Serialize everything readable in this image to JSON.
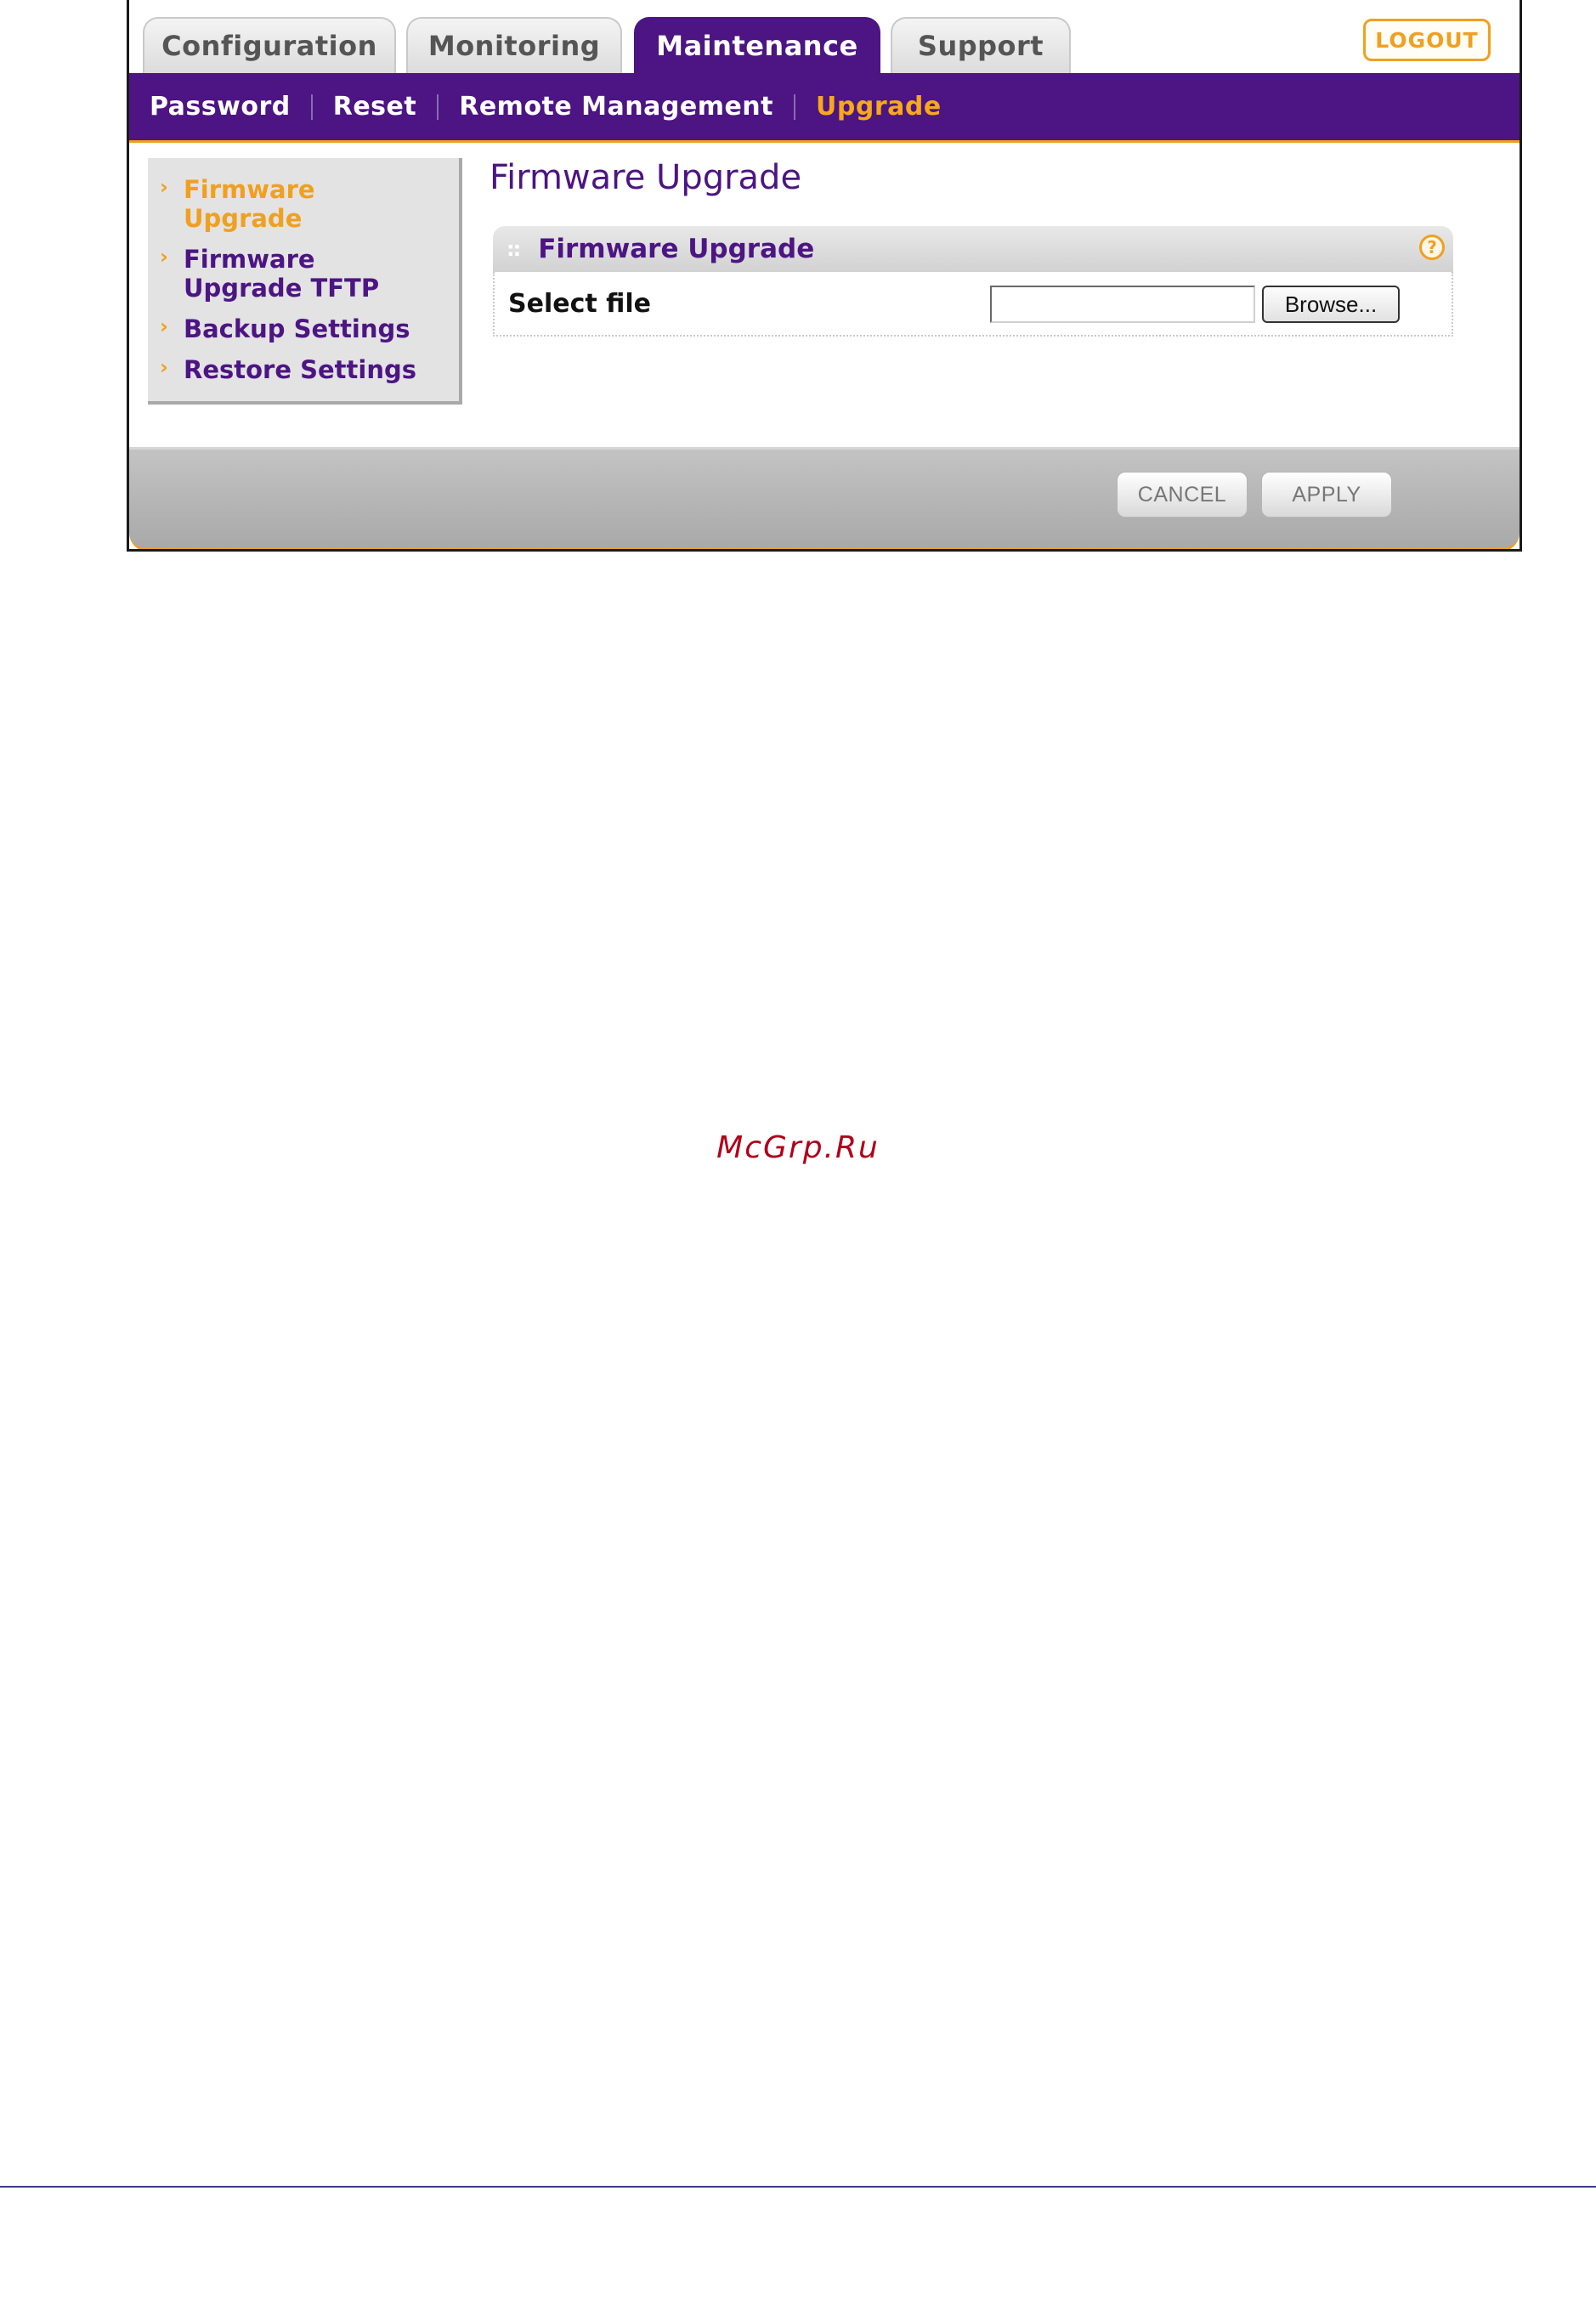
{
  "tabs": [
    {
      "label": "Configuration",
      "active": false
    },
    {
      "label": "Monitoring",
      "active": false
    },
    {
      "label": "Maintenance",
      "active": true
    },
    {
      "label": "Support",
      "active": false
    }
  ],
  "logout_label": "LOGOUT",
  "subnav": {
    "items": [
      "Password",
      "Reset",
      "Remote Management",
      "Upgrade"
    ],
    "current": "Upgrade"
  },
  "sidebar": {
    "items": [
      {
        "label": "Firmware Upgrade",
        "current": true
      },
      {
        "label": "Firmware Upgrade TFTP",
        "current": false
      },
      {
        "label": "Backup Settings",
        "current": false
      },
      {
        "label": "Restore Settings",
        "current": false
      }
    ]
  },
  "main": {
    "page_title": "Firmware Upgrade",
    "section_title": "Firmware Upgrade",
    "select_file_label": "Select file",
    "file_value": "",
    "browse_label": "Browse..."
  },
  "footer": {
    "cancel_label": "CANCEL",
    "apply_label": "APPLY"
  },
  "watermark": "McGrp.Ru",
  "colors": {
    "brand_purple": "#4c1583",
    "accent_orange": "#f0a020",
    "watermark_red": "#b1001a"
  },
  "icons": {
    "help": "help-icon",
    "chevron": "chevron-right-icon"
  }
}
